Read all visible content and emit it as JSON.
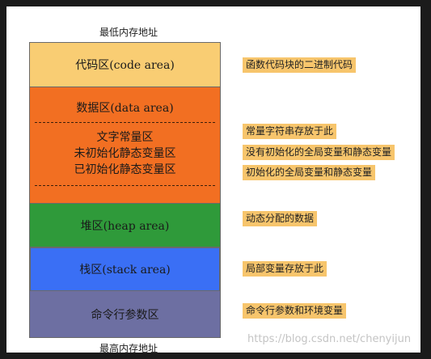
{
  "top_label": "最低内存地址",
  "bottom_label": "最高内存地址",
  "segments": {
    "code": "代码区(code area)",
    "data_title": "数据区(data area)",
    "data_lines": [
      "文字常量区",
      "未初始化静态变量区",
      "已初始化静态变量区"
    ],
    "heap": "堆区(heap area)",
    "stack": "栈区(stack area)",
    "cmd": "命令行参数区"
  },
  "notes": [
    "函数代码块的二进制代码",
    "常量字符串存放于此",
    "没有初始化的全局变量和静态变量",
    "初始化的全局变量和静态变量",
    "动态分配的数据",
    "局部变量存放于此",
    "命令行参数和环境变量"
  ],
  "watermark": "https://blog.csdn.net/chenyijun",
  "colors": {
    "code": "#f9cd73",
    "data": "#f26f22",
    "heap": "#2f9a3a",
    "stack": "#3a6ff5",
    "cmd": "#6d6fa2",
    "note_bg": "#f7c56c"
  }
}
